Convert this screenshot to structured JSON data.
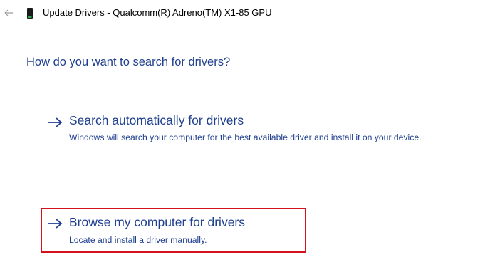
{
  "window": {
    "back_icon": "back-arrow-icon",
    "device_icon": "gpu-device-icon",
    "title": "Update Drivers - Qualcomm(R) Adreno(TM) X1-85 GPU"
  },
  "page": {
    "heading": "How do you want to search for drivers?"
  },
  "options": [
    {
      "icon": "right-arrow-icon",
      "title": "Search automatically for drivers",
      "description": "Windows will search your computer for the best available driver and install it on your device."
    },
    {
      "icon": "right-arrow-icon",
      "title": "Browse my computer for drivers",
      "description": "Locate and install a driver manually.",
      "highlighted": true
    }
  ],
  "colors": {
    "link_blue": "#1f3f8f",
    "highlight_red": "#d3121e",
    "icon_gray": "#9a9a9a",
    "device_dark": "#1a1a1a",
    "device_green": "#2fa84a"
  }
}
